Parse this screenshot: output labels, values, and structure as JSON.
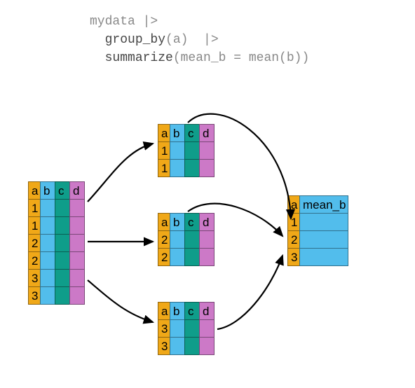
{
  "code": {
    "line1": "mydata |>",
    "line2_indent": "  ",
    "line2_fn": "group_by",
    "line2_args": "(a)  |>",
    "line3_indent": "  ",
    "line3_fn": "summarize",
    "line3_args": "(mean_b = mean(b))"
  },
  "colors": {
    "a": "#f0a818",
    "b": "#52bdec",
    "c": "#0f9d8a",
    "d": "#cc79c7"
  },
  "source_table": {
    "headers": [
      "a",
      "b",
      "c",
      "d"
    ],
    "rows": [
      {
        "a": "1",
        "b": "",
        "c": "",
        "d": ""
      },
      {
        "a": "1",
        "b": "",
        "c": "",
        "d": ""
      },
      {
        "a": "2",
        "b": "",
        "c": "",
        "d": ""
      },
      {
        "a": "2",
        "b": "",
        "c": "",
        "d": ""
      },
      {
        "a": "3",
        "b": "",
        "c": "",
        "d": ""
      },
      {
        "a": "3",
        "b": "",
        "c": "",
        "d": ""
      }
    ]
  },
  "group_tables": [
    {
      "headers": [
        "a",
        "b",
        "c",
        "d"
      ],
      "rows": [
        {
          "a": "1",
          "b": "",
          "c": "",
          "d": ""
        },
        {
          "a": "1",
          "b": "",
          "c": "",
          "d": ""
        }
      ]
    },
    {
      "headers": [
        "a",
        "b",
        "c",
        "d"
      ],
      "rows": [
        {
          "a": "2",
          "b": "",
          "c": "",
          "d": ""
        },
        {
          "a": "2",
          "b": "",
          "c": "",
          "d": ""
        }
      ]
    },
    {
      "headers": [
        "a",
        "b",
        "c",
        "d"
      ],
      "rows": [
        {
          "a": "3",
          "b": "",
          "c": "",
          "d": ""
        },
        {
          "a": "3",
          "b": "",
          "c": "",
          "d": ""
        }
      ]
    }
  ],
  "result_table": {
    "headers": [
      "a",
      "mean_b"
    ],
    "rows": [
      {
        "a": "1",
        "mean_b": ""
      },
      {
        "a": "2",
        "mean_b": ""
      },
      {
        "a": "3",
        "mean_b": ""
      }
    ]
  }
}
